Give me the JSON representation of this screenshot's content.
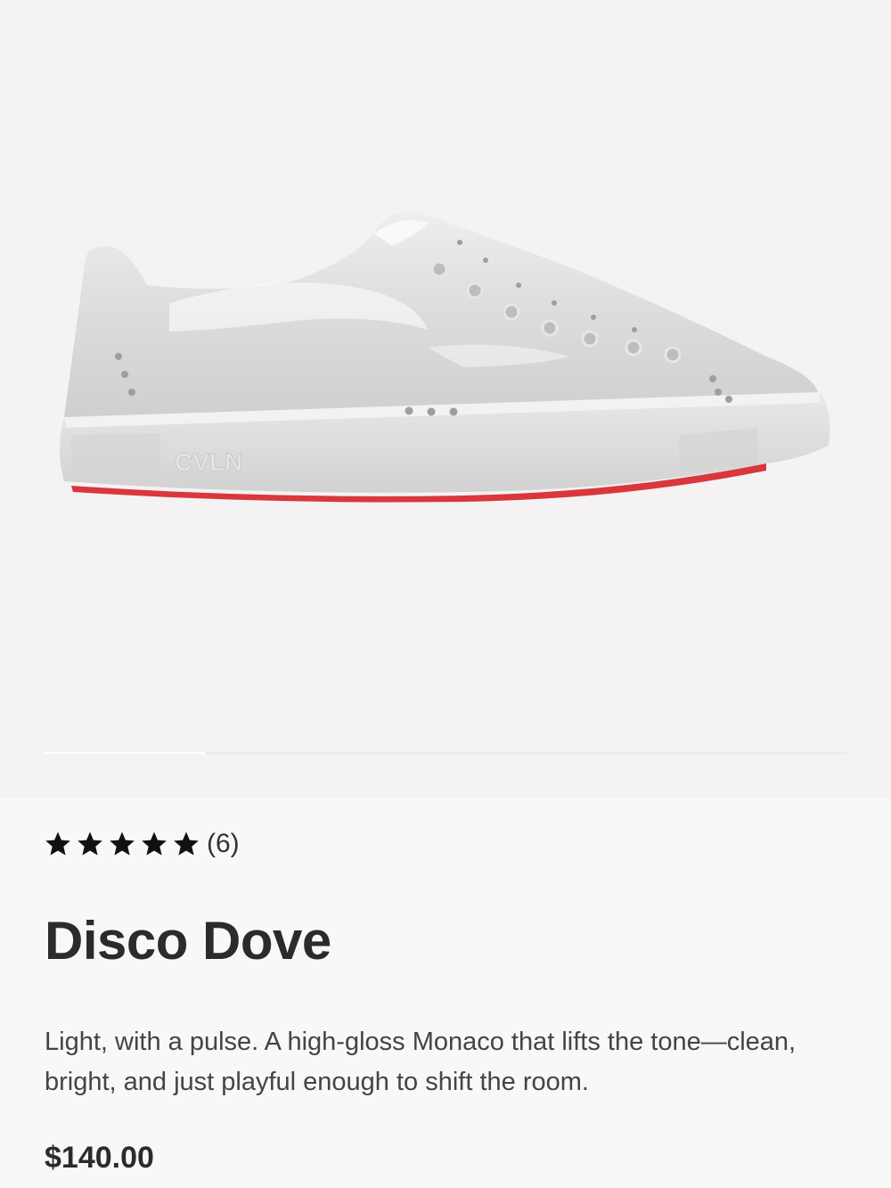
{
  "product": {
    "image_alt": "Disco Dove sneaker",
    "sole_logo": "CVLN",
    "gallery_progress": 0.2,
    "rating": {
      "stars": 5,
      "max_stars": 5,
      "count_label": "(6)"
    },
    "name": "Disco Dove",
    "description": "Light, with a pulse. A high-gloss Monaco that lifts the tone—clean, bright, and just playful enough to shift the room.",
    "price": "$140.00"
  },
  "colors": {
    "hero_bg": "#f4f2f3",
    "page_bg": "#f8f8f8",
    "shoe_upper": "#dcdcdc",
    "sole_accent": "#d9373c",
    "star": "#111111"
  }
}
